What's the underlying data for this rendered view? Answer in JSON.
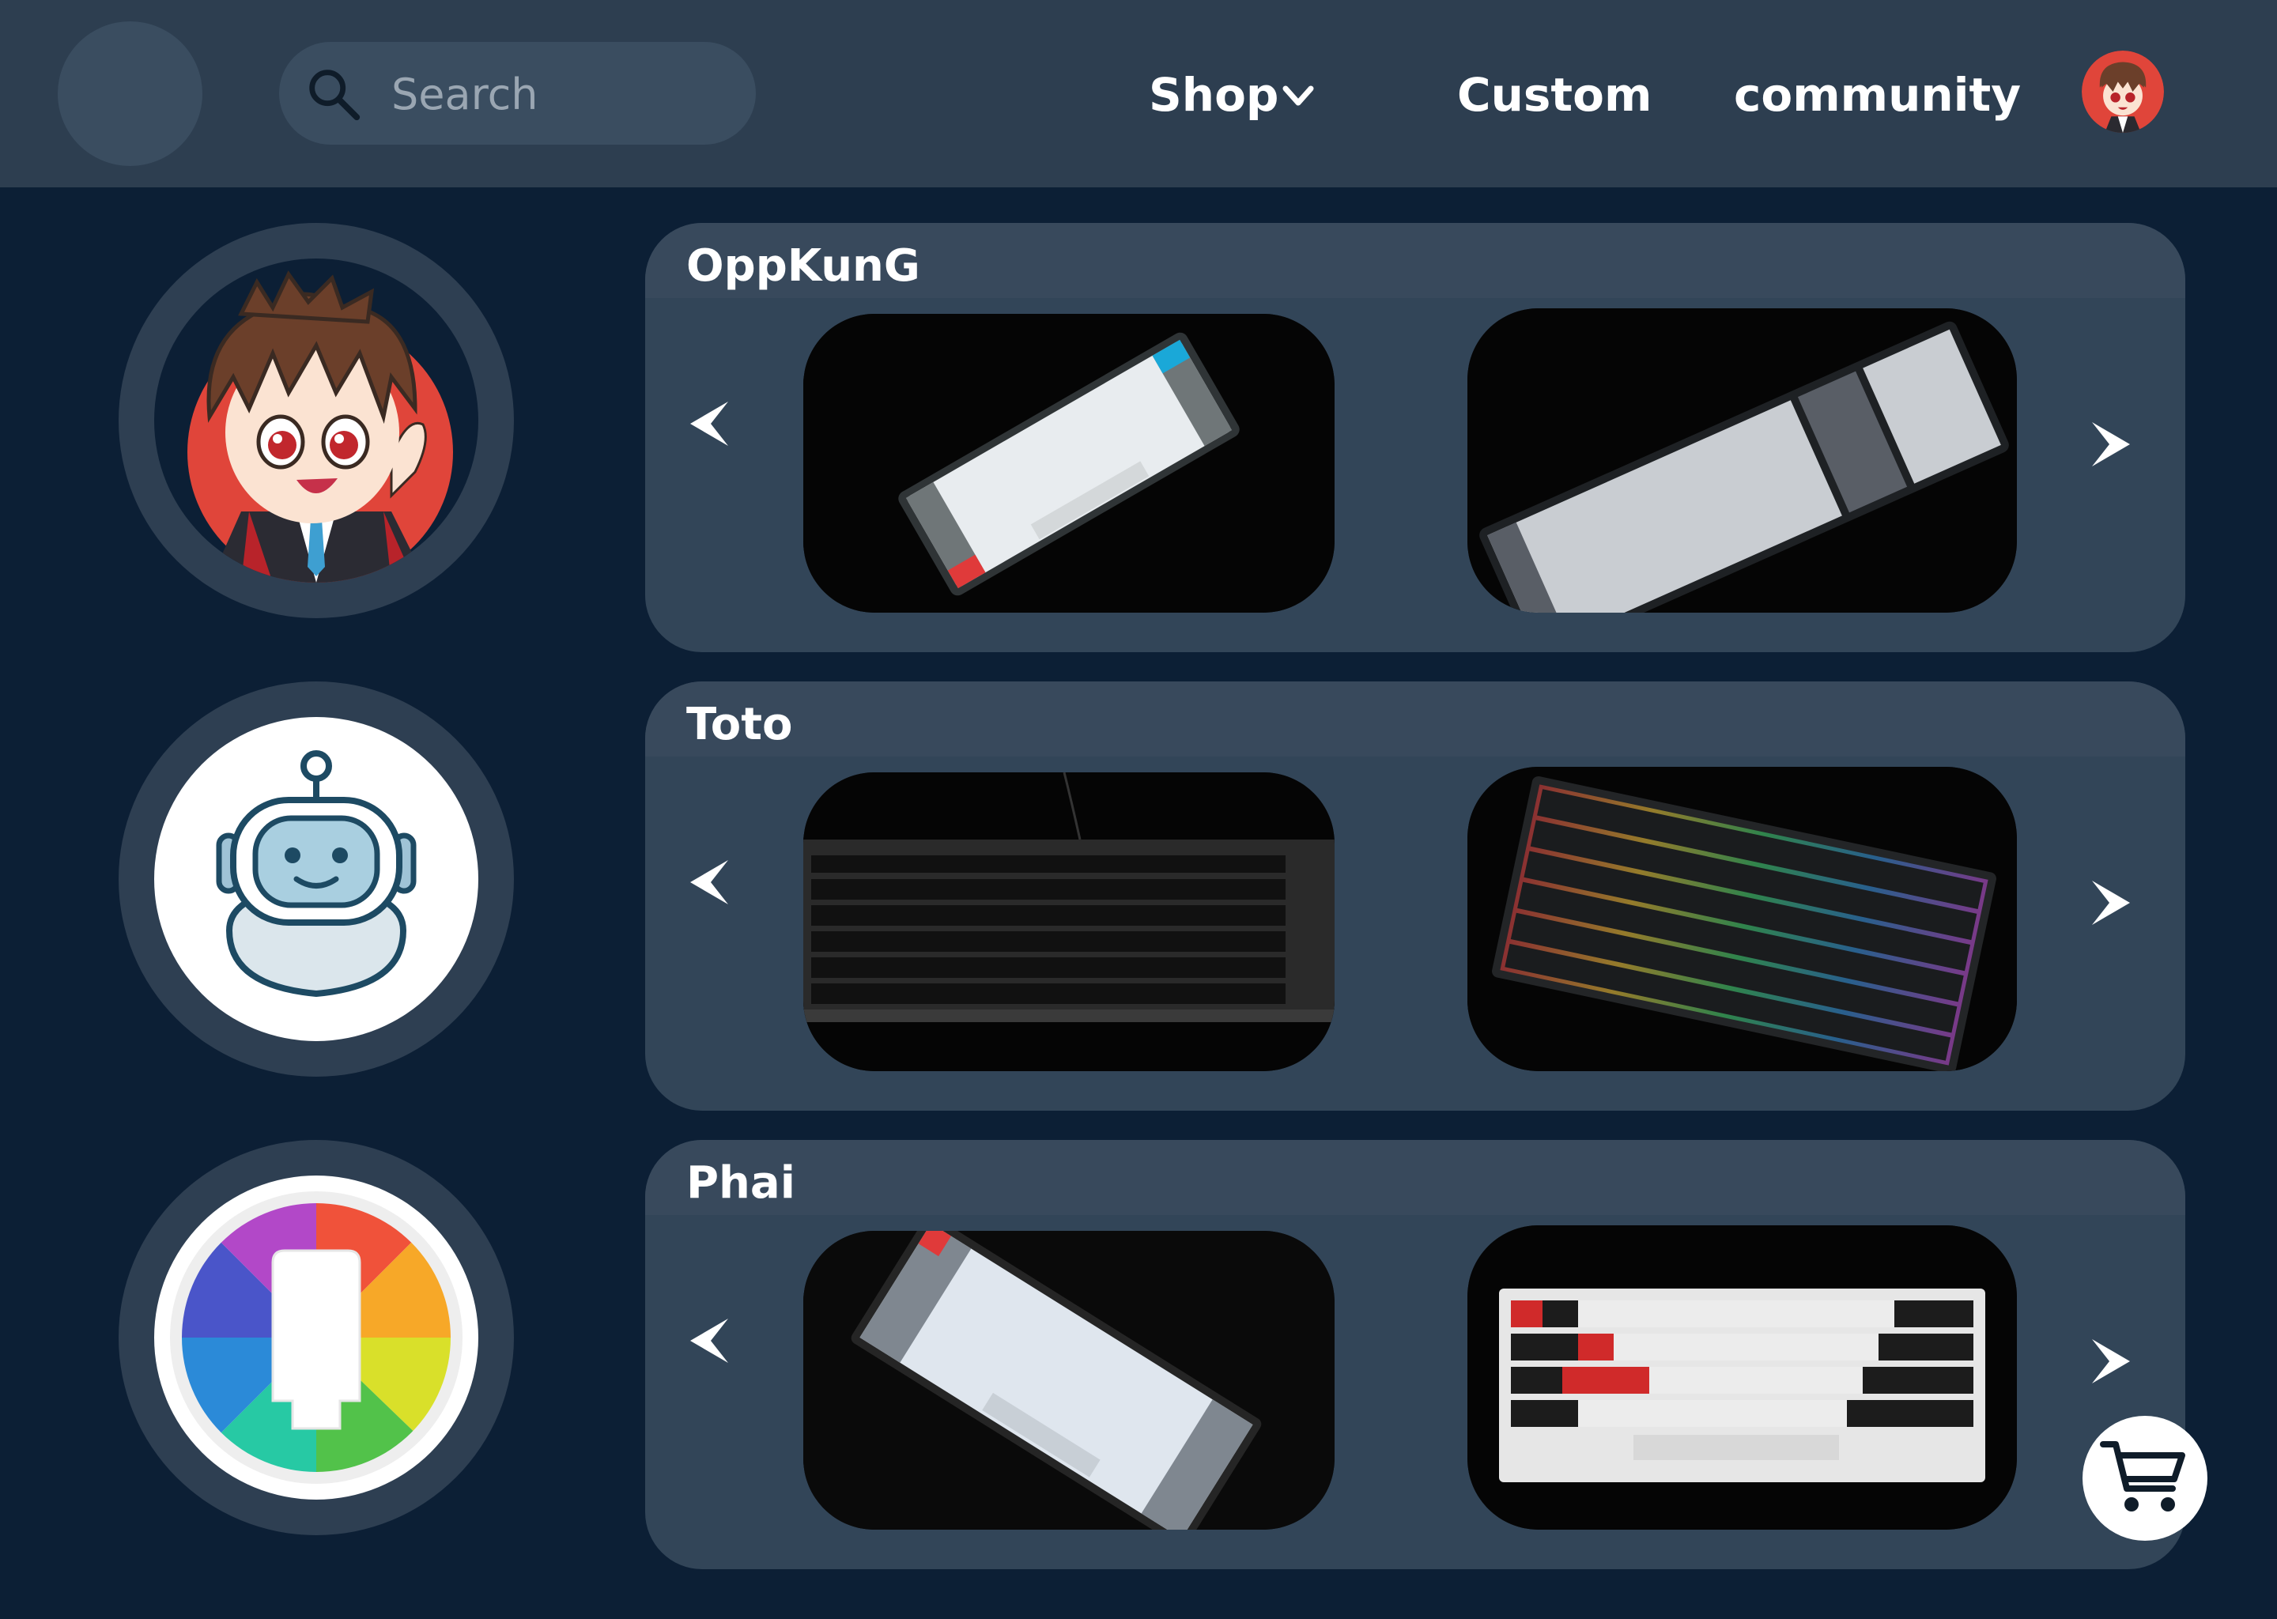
{
  "header": {
    "search": {
      "placeholder": "Search"
    },
    "nav": {
      "shop": "Shop",
      "custom": "Custom",
      "community": "community"
    }
  },
  "sidebar": {
    "avatars": [
      {
        "name": "anime-avatar"
      },
      {
        "name": "robot-avatar"
      },
      {
        "name": "color-wheel-avatar"
      }
    ]
  },
  "cards": [
    {
      "title": "OppKunG",
      "images": [
        "white-60-percent-keyboard",
        "gray-white-full-size-keyboard"
      ]
    },
    {
      "title": "Toto",
      "images": [
        "black-full-size-keyboard",
        "rgb-tenkeyless-keyboard"
      ]
    },
    {
      "title": "Phai",
      "images": [
        "gray-white-compact-keyboard",
        "hhkb-keyboard"
      ]
    }
  ],
  "colors": {
    "background": "#0c1f35",
    "header": "#2d3e50",
    "card": "#324558",
    "accent_red": "#e0453a"
  },
  "icons": [
    "search-icon",
    "chevron-down-icon",
    "arrow-left-icon",
    "arrow-right-icon",
    "cart-icon"
  ]
}
